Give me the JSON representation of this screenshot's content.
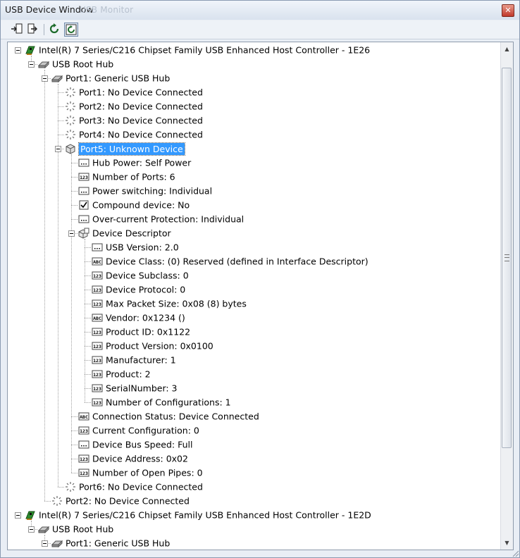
{
  "window": {
    "title": "USB Device Window",
    "ghost_title": "USB Monitor",
    "close_glyph": "✕"
  },
  "toolbar": {
    "buttons": [
      {
        "icon": "import-icon"
      },
      {
        "icon": "export-icon"
      },
      {
        "icon": "refresh-icon"
      },
      {
        "icon": "auto-refresh-icon",
        "active": true
      }
    ]
  },
  "tree": {
    "selected": "Port5: Unknown Device",
    "rows": [
      {
        "depth": 0,
        "icon": "controller",
        "text": "Intel(R) 7 Series/C216 Chipset Family USB Enhanced Host Controller - 1E26",
        "exp": true
      },
      {
        "depth": 1,
        "icon": "hub",
        "text": "USB Root Hub",
        "exp": true
      },
      {
        "depth": 2,
        "icon": "hub",
        "text": "Port1: Generic USB Hub",
        "exp": true
      },
      {
        "depth": 3,
        "icon": "empty-port",
        "text": "Port1: No Device Connected"
      },
      {
        "depth": 3,
        "icon": "empty-port",
        "text": "Port2: No Device Connected"
      },
      {
        "depth": 3,
        "icon": "empty-port",
        "text": "Port3: No Device Connected"
      },
      {
        "depth": 3,
        "icon": "empty-port",
        "text": "Port4: No Device Connected"
      },
      {
        "depth": 3,
        "icon": "unknown-device",
        "text": "Port5: Unknown Device",
        "exp": true,
        "selected": true
      },
      {
        "depth": 4,
        "icon": "dots",
        "text": "Hub Power: Self Power"
      },
      {
        "depth": 4,
        "icon": "num",
        "text": "Number of Ports: 6"
      },
      {
        "depth": 4,
        "icon": "dots",
        "text": "Power switching: Individual"
      },
      {
        "depth": 4,
        "icon": "check",
        "text": "Compound device: No"
      },
      {
        "depth": 4,
        "icon": "dots",
        "text": "Over-current Protection: Individual"
      },
      {
        "depth": 4,
        "icon": "descriptor",
        "text": "Device Descriptor",
        "exp": true
      },
      {
        "depth": 5,
        "icon": "dots",
        "text": "USB Version: 2.0"
      },
      {
        "depth": 5,
        "icon": "abc",
        "text": "Device Class: (0) Reserved (defined in Interface Descriptor)"
      },
      {
        "depth": 5,
        "icon": "num",
        "text": "Device Subclass: 0"
      },
      {
        "depth": 5,
        "icon": "num",
        "text": "Device Protocol: 0"
      },
      {
        "depth": 5,
        "icon": "num",
        "text": "Max Packet Size: 0x08 (8) bytes"
      },
      {
        "depth": 5,
        "icon": "abc",
        "text": "Vendor: 0x1234 ()"
      },
      {
        "depth": 5,
        "icon": "num",
        "text": "Product ID: 0x1122"
      },
      {
        "depth": 5,
        "icon": "num",
        "text": "Product Version: 0x0100"
      },
      {
        "depth": 5,
        "icon": "num",
        "text": "Manufacturer: 1"
      },
      {
        "depth": 5,
        "icon": "num",
        "text": "Product: 2"
      },
      {
        "depth": 5,
        "icon": "num",
        "text": "SerialNumber: 3"
      },
      {
        "depth": 5,
        "icon": "num",
        "text": "Number of Configurations: 1"
      },
      {
        "depth": 4,
        "icon": "abc",
        "text": "Connection Status: Device Connected"
      },
      {
        "depth": 4,
        "icon": "num",
        "text": "Current Configuration: 0"
      },
      {
        "depth": 4,
        "icon": "dots",
        "text": "Device Bus Speed: Full"
      },
      {
        "depth": 4,
        "icon": "num",
        "text": "Device Address: 0x02"
      },
      {
        "depth": 4,
        "icon": "num",
        "text": "Number of Open Pipes: 0"
      },
      {
        "depth": 3,
        "icon": "empty-port",
        "text": "Port6: No Device Connected"
      },
      {
        "depth": 2,
        "icon": "empty-port",
        "text": "Port2: No Device Connected"
      },
      {
        "depth": 0,
        "icon": "controller",
        "text": "Intel(R) 7 Series/C216 Chipset Family USB Enhanced Host Controller - 1E2D",
        "exp": true
      },
      {
        "depth": 1,
        "icon": "hub",
        "text": "USB Root Hub",
        "exp": true
      },
      {
        "depth": 2,
        "icon": "hub",
        "text": "Port1: Generic USB Hub",
        "exp": true
      }
    ]
  },
  "icon_labels": {
    "num": "123",
    "abc": "ABC"
  }
}
